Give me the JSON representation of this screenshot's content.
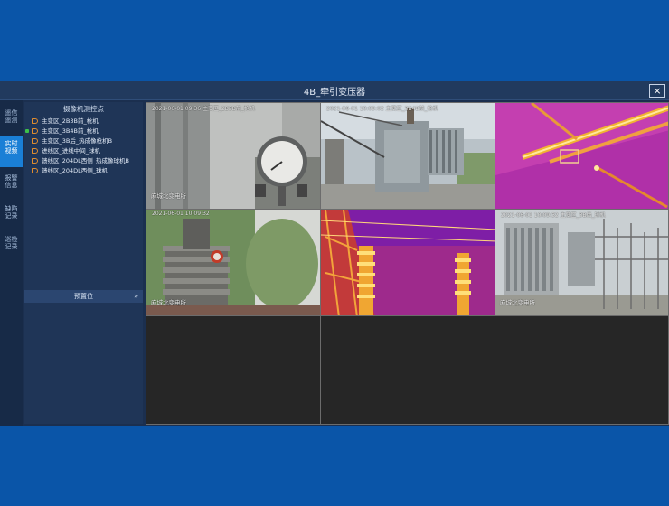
{
  "window": {
    "title": "4B_牵引变压器",
    "close_icon": "×"
  },
  "nav": [
    {
      "line1": "遥信",
      "line2": "遥测",
      "active": false
    },
    {
      "line1": "实时",
      "line2": "视频",
      "active": true
    },
    {
      "line1": "报警",
      "line2": "信息",
      "active": false
    },
    {
      "line1": "缺陷",
      "line2": "记录",
      "active": false
    },
    {
      "line1": "巡检",
      "line2": "记录",
      "active": false
    }
  ],
  "camera_panel": {
    "title": "摄像机测控点",
    "cameras": [
      {
        "label": "主变区_2B3B前_枪机",
        "selected": false
      },
      {
        "label": "主变区_3B4B前_枪机",
        "selected": true
      },
      {
        "label": "主变区_3B后_热成像枪机B",
        "selected": false
      },
      {
        "label": "进线区_进线中间_球机",
        "selected": false
      },
      {
        "label": "馈线区_204DL西侧_热成像球机B",
        "selected": false
      },
      {
        "label": "馈线区_204DL西侧_球机",
        "selected": false
      }
    ],
    "preset_label": "预置位",
    "preset_icon": "»"
  },
  "video": {
    "cells": [
      {
        "osd_top": "2021-06-01 09:36   主变区_2B3B前_枪机",
        "osd_bottom": "麻城北变电所"
      },
      {
        "osd_top": "2021-06-01 10:09:02  主变区_3B4B前_枪机",
        "osd_bottom": ""
      },
      {
        "osd_top": "",
        "osd_bottom": ""
      },
      {
        "osd_top": "2021-06-01 10:09:32",
        "osd_bottom": "麻城北变电所"
      },
      {
        "osd_top": "",
        "osd_bottom": ""
      },
      {
        "osd_top": "2021-06-01 10:09:32  主变区_3B后_球机",
        "osd_bottom": "麻城北变电所"
      }
    ]
  }
}
